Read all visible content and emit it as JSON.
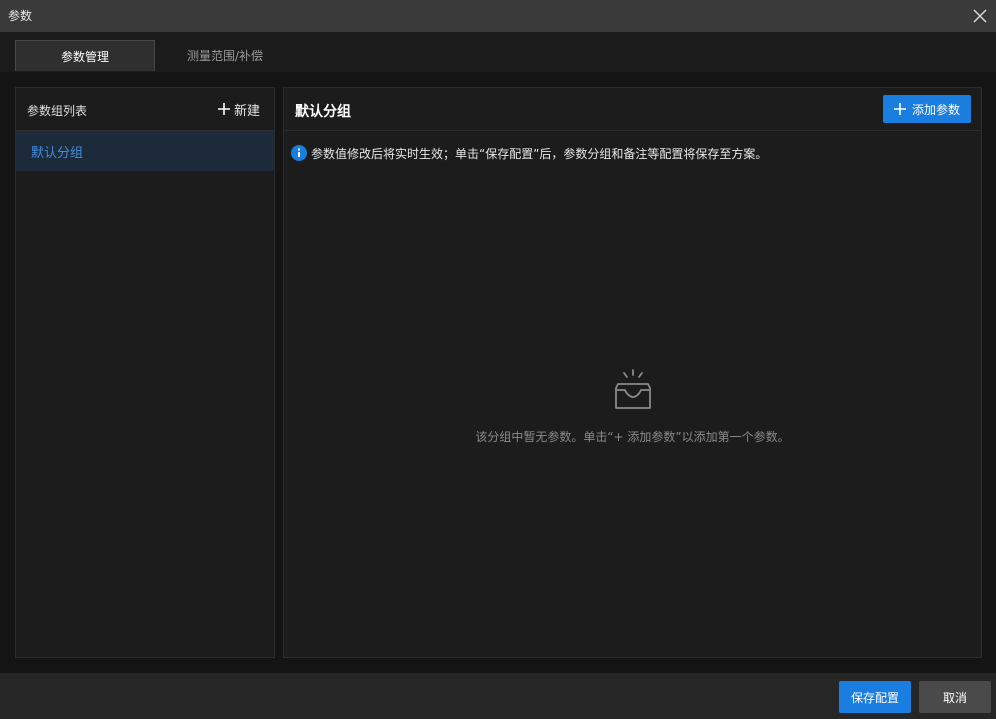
{
  "window": {
    "title": "参数"
  },
  "tabs": [
    {
      "label": "参数管理",
      "active": true
    },
    {
      "label": "测量范围/补偿",
      "active": false
    }
  ],
  "left_panel": {
    "title": "参数组列表",
    "new_label": "新建",
    "groups": [
      {
        "label": "默认分组",
        "selected": true
      }
    ]
  },
  "right_panel": {
    "title": "默认分组",
    "add_label": "添加参数",
    "info_text": "参数值修改后将实时生效；单击“保存配置”后，参数分组和备注等配置将保存至方案。",
    "empty_text": "该分组中暂无参数。单击“+ 添加参数”以添加第一个参数。"
  },
  "footer": {
    "save_label": "保存配置",
    "cancel_label": "取消"
  },
  "colors": {
    "accent": "#1a7de0",
    "selected_text": "#3f8fe0",
    "selected_bg": "#1d2a3a"
  },
  "icons": {
    "close": "close-icon",
    "plus": "plus-icon",
    "info": "info-icon",
    "empty": "empty-inbox-icon"
  }
}
